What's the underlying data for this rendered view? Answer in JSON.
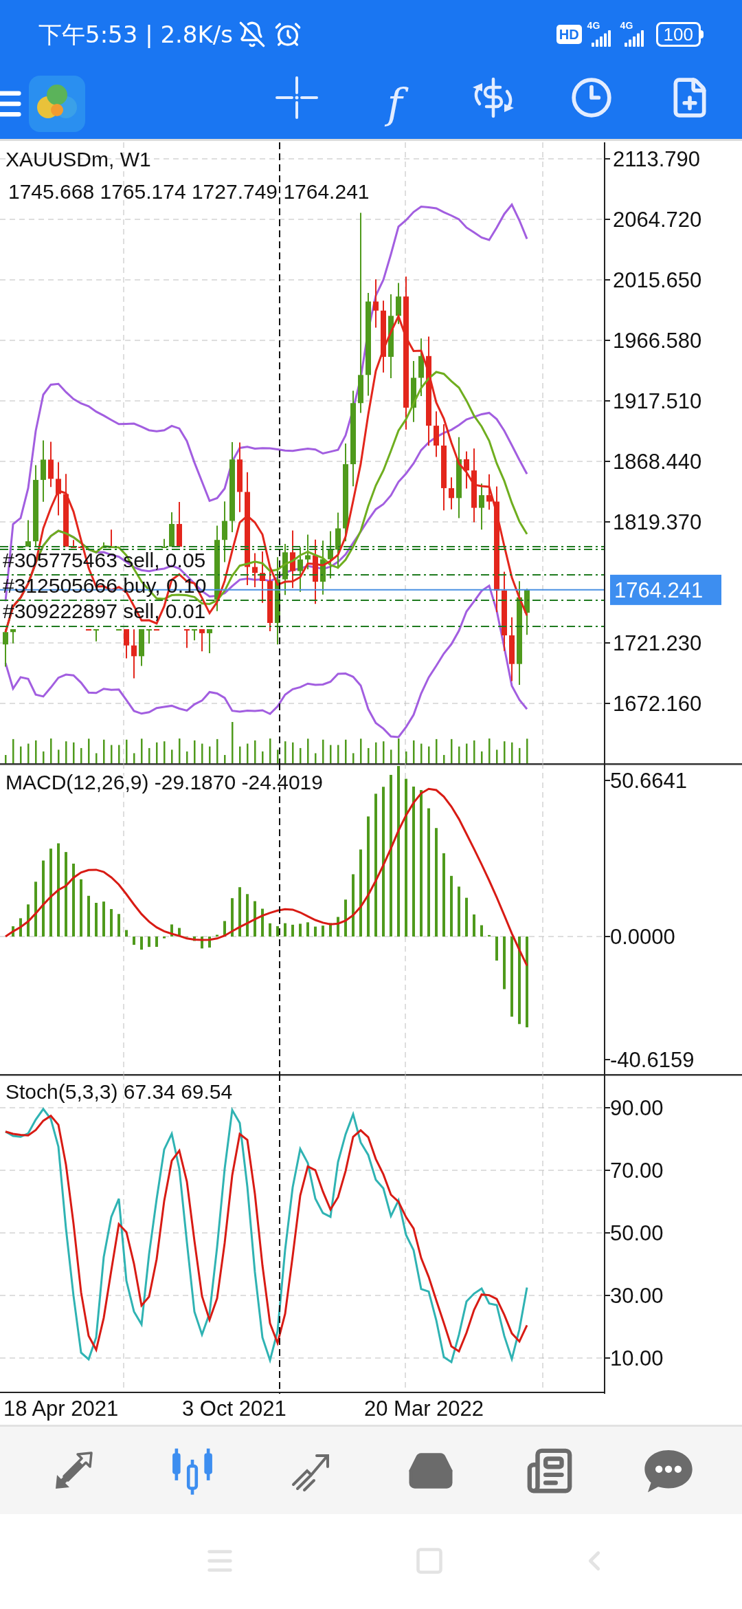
{
  "status_bar": {
    "time_speed": "下午5:53 | 2.8K/s",
    "hd": "HD",
    "network_1": "4G",
    "network_2": "4G",
    "battery": "100"
  },
  "toolbar": {
    "function_glyph": "f"
  },
  "main_chart": {
    "symbol": "XAUUSDm, W1",
    "ohlc": "1745.668 1765.174 1727.749 1764.241",
    "price_axis": [
      "2113.790",
      "2064.720",
      "2015.650",
      "1966.580",
      "1917.510",
      "1868.440",
      "1819.370",
      "1721.230",
      "1672.160"
    ],
    "current_price": "1764.241",
    "orders": [
      {
        "label": "#305775463 sell, 0.05"
      },
      {
        "label": "#312505666 buy, 0.10"
      },
      {
        "label": "#309222897 sell, 0.01"
      }
    ]
  },
  "macd": {
    "label": "MACD(12,26,9) -29.1870 -24.4019",
    "axis": [
      "50.6641",
      "0.0000",
      "-40.6159"
    ]
  },
  "stochastic": {
    "label": "Stoch(5,3,3) 67.34 69.54",
    "axis": [
      "90.00",
      "70.00",
      "50.00",
      "30.00",
      "10.00"
    ]
  },
  "time_axis": [
    "18 Apr 2021",
    "3 Oct 2021",
    "20 Mar 2022"
  ],
  "bottom_nav": [
    {
      "selected": false
    },
    {
      "selected": true
    },
    {
      "selected": false
    },
    {
      "selected": false
    },
    {
      "selected": false
    },
    {
      "selected": false
    }
  ]
}
